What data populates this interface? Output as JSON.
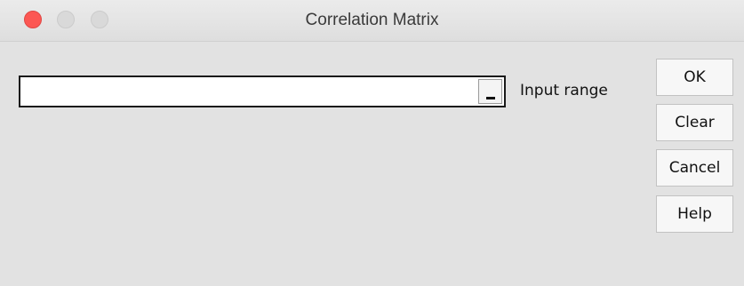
{
  "window": {
    "title": "Correlation Matrix",
    "controls": [
      "close",
      "minimize",
      "zoom"
    ]
  },
  "input_range": {
    "label": "Input range",
    "value": "",
    "picker_icon": "range-selector-icon"
  },
  "buttons": {
    "ok": "OK",
    "clear": "Clear",
    "cancel": "Cancel",
    "help": "Help"
  },
  "colors": {
    "close_button": "#fc5753",
    "inactive_control": "#d9d9d9",
    "window_background": "#e2e2e2"
  }
}
